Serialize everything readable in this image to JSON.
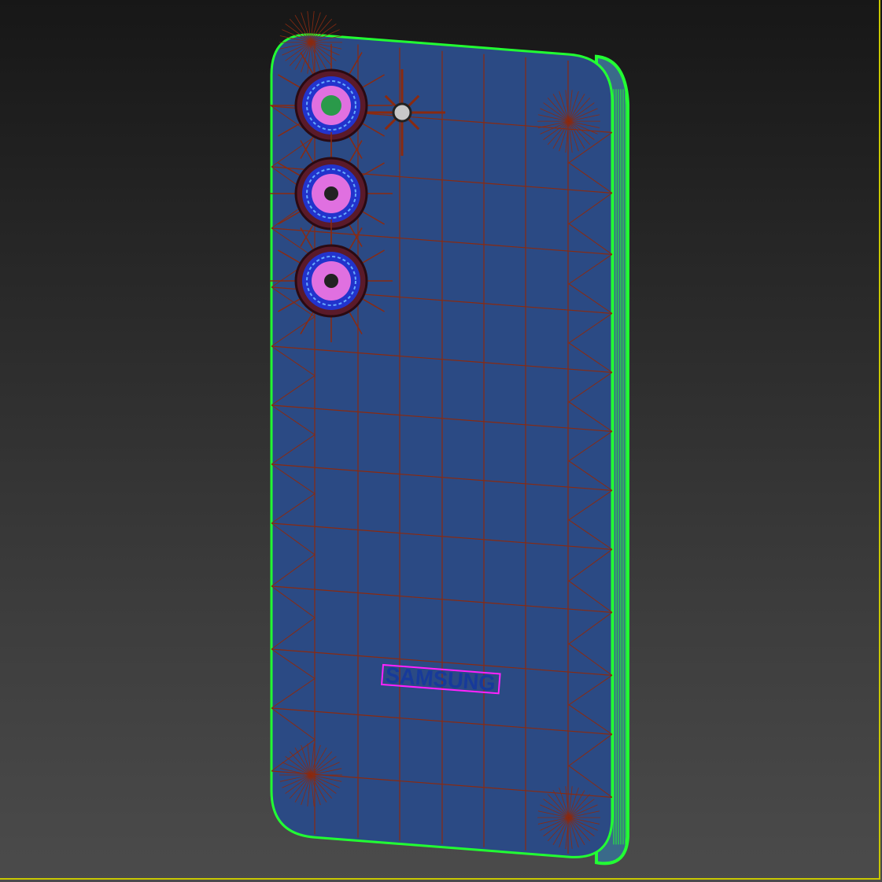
{
  "viewport": {
    "shading_mode": "wireframe-over-shaded",
    "colors": {
      "body_fill": "#2b4a84",
      "wire": "#8a2a10",
      "silhouette": "#22ff33",
      "lens_fill": "#e070e0",
      "lens_ring": "#5a1a2a",
      "logo_outline": "#ff22ff",
      "logo_text": "#173a9a",
      "viewport_border": "#c8c800"
    }
  },
  "model": {
    "name": "phone-back",
    "logo_text": "SAMSUNG",
    "camera_lenses": 3
  }
}
